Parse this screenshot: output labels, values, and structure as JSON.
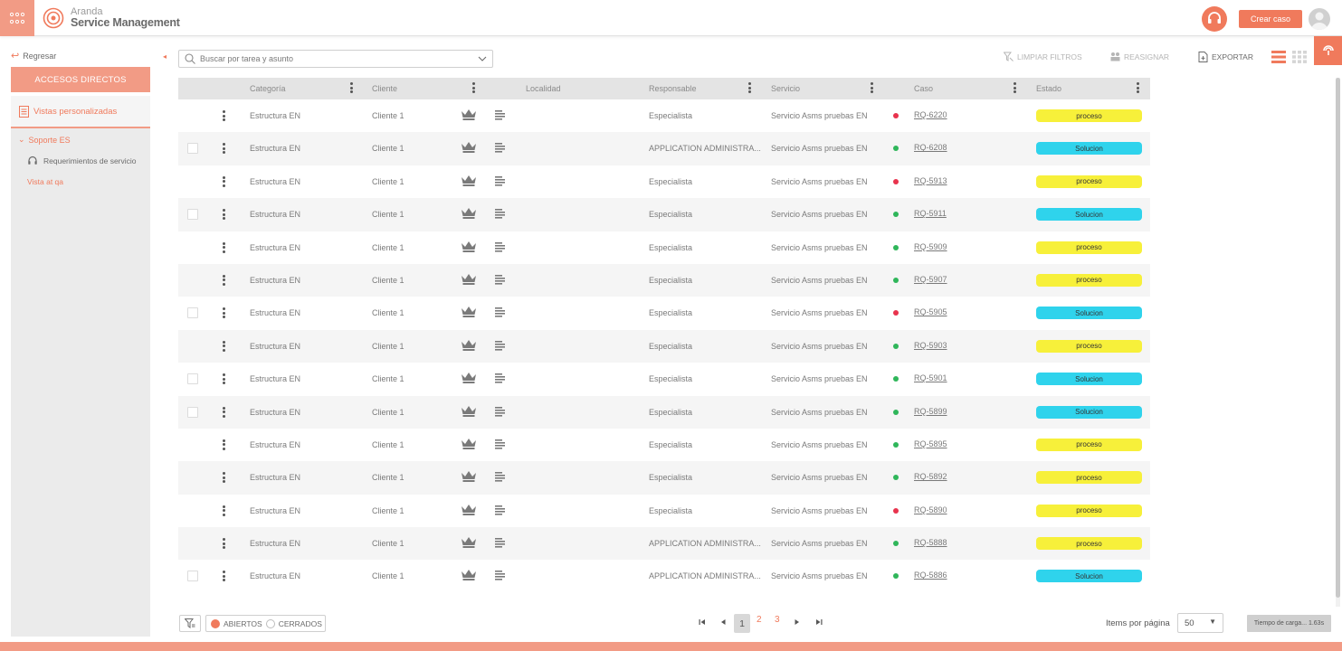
{
  "colors": {
    "accent": "#f07a5c",
    "accent_light": "#f29b85",
    "proceso": "#f7f03a",
    "solucion": "#2fd3ec",
    "dot_red": "#e8334d",
    "dot_green": "#2fb65a"
  },
  "header": {
    "brand_line1": "Aranda",
    "brand_line2": "Service Management",
    "create_button": "Crear caso"
  },
  "sidebar": {
    "back": "Regresar",
    "shortcuts": "ACCESOS DIRECTOS",
    "custom_views": "Vistas personalizadas",
    "group": "Soporte ES",
    "item": "Requerimientos de servicio",
    "view": "Vista at qa"
  },
  "toolbar": {
    "search_placeholder": "Buscar por tarea y asunto",
    "clear_filters": "LIMPIAR FILTROS",
    "reassign": "REASIGNAR",
    "export": "EXPORTAR"
  },
  "table": {
    "columns": [
      "Categoría",
      "Cliente",
      "Localidad",
      "Responsable",
      "Servicio",
      "Caso",
      "Estado"
    ],
    "rows": [
      {
        "categoria": "Estructura EN",
        "cliente": "Cliente 1",
        "responsable": "Especialista",
        "servicio": "Servicio Asms pruebas EN",
        "caso": "RQ-6220",
        "dot": "red",
        "estado": "proceso",
        "checkbox": false
      },
      {
        "categoria": "Estructura EN",
        "cliente": "Cliente 1",
        "responsable": "APPLICATION ADMINISTRA...",
        "servicio": "Servicio Asms pruebas EN",
        "caso": "RQ-6208",
        "dot": "green",
        "estado": "Solucion",
        "checkbox": true
      },
      {
        "categoria": "Estructura EN",
        "cliente": "Cliente 1",
        "responsable": "Especialista",
        "servicio": "Servicio Asms pruebas EN",
        "caso": "RQ-5913",
        "dot": "red",
        "estado": "proceso",
        "checkbox": false
      },
      {
        "categoria": "Estructura EN",
        "cliente": "Cliente 1",
        "responsable": "Especialista",
        "servicio": "Servicio Asms pruebas EN",
        "caso": "RQ-5911",
        "dot": "green",
        "estado": "Solucion",
        "checkbox": true
      },
      {
        "categoria": "Estructura EN",
        "cliente": "Cliente 1",
        "responsable": "Especialista",
        "servicio": "Servicio Asms pruebas EN",
        "caso": "RQ-5909",
        "dot": "green",
        "estado": "proceso",
        "checkbox": false
      },
      {
        "categoria": "Estructura EN",
        "cliente": "Cliente 1",
        "responsable": "Especialista",
        "servicio": "Servicio Asms pruebas EN",
        "caso": "RQ-5907",
        "dot": "green",
        "estado": "proceso",
        "checkbox": false
      },
      {
        "categoria": "Estructura EN",
        "cliente": "Cliente 1",
        "responsable": "Especialista",
        "servicio": "Servicio Asms pruebas EN",
        "caso": "RQ-5905",
        "dot": "red",
        "estado": "Solucion",
        "checkbox": true
      },
      {
        "categoria": "Estructura EN",
        "cliente": "Cliente 1",
        "responsable": "Especialista",
        "servicio": "Servicio Asms pruebas EN",
        "caso": "RQ-5903",
        "dot": "green",
        "estado": "proceso",
        "checkbox": false
      },
      {
        "categoria": "Estructura EN",
        "cliente": "Cliente 1",
        "responsable": "Especialista",
        "servicio": "Servicio Asms pruebas EN",
        "caso": "RQ-5901",
        "dot": "green",
        "estado": "Solucion",
        "checkbox": true
      },
      {
        "categoria": "Estructura EN",
        "cliente": "Cliente 1",
        "responsable": "Especialista",
        "servicio": "Servicio Asms pruebas EN",
        "caso": "RQ-5899",
        "dot": "green",
        "estado": "Solucion",
        "checkbox": true
      },
      {
        "categoria": "Estructura EN",
        "cliente": "Cliente 1",
        "responsable": "Especialista",
        "servicio": "Servicio Asms pruebas EN",
        "caso": "RQ-5895",
        "dot": "green",
        "estado": "proceso",
        "checkbox": false
      },
      {
        "categoria": "Estructura EN",
        "cliente": "Cliente 1",
        "responsable": "Especialista",
        "servicio": "Servicio Asms pruebas EN",
        "caso": "RQ-5892",
        "dot": "green",
        "estado": "proceso",
        "checkbox": false
      },
      {
        "categoria": "Estructura EN",
        "cliente": "Cliente 1",
        "responsable": "Especialista",
        "servicio": "Servicio Asms pruebas EN",
        "caso": "RQ-5890",
        "dot": "red",
        "estado": "proceso",
        "checkbox": false
      },
      {
        "categoria": "Estructura EN",
        "cliente": "Cliente 1",
        "responsable": "APPLICATION ADMINISTRA...",
        "servicio": "Servicio Asms pruebas EN",
        "caso": "RQ-5888",
        "dot": "green",
        "estado": "proceso",
        "checkbox": false
      },
      {
        "categoria": "Estructura EN",
        "cliente": "Cliente 1",
        "responsable": "APPLICATION ADMINISTRA...",
        "servicio": "Servicio Asms pruebas EN",
        "caso": "RQ-5886",
        "dot": "green",
        "estado": "Solucion",
        "checkbox": true
      }
    ]
  },
  "footer": {
    "open": "ABIERTOS",
    "closed": "CERRADOS",
    "pages": [
      "1",
      "2",
      "3"
    ],
    "current_page": "1",
    "items_label": "Items por página",
    "items_value": "50",
    "load_time": "Tiempo de carga... 1.63s"
  }
}
